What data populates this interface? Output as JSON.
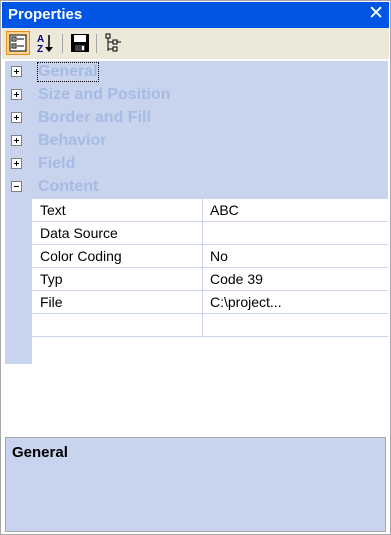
{
  "window": {
    "title": "Properties",
    "close_glyph": "✕"
  },
  "toolbar": {
    "buttons": [
      {
        "name": "categorized-view-icon",
        "pressed": true
      },
      {
        "name": "sort-alphabetical-icon",
        "pressed": false
      },
      {
        "name": "save-icon",
        "pressed": false
      },
      {
        "name": "hierarchy-icon",
        "pressed": false
      }
    ]
  },
  "categories": [
    {
      "label": "General",
      "expanded": false
    },
    {
      "label": "Size and Position",
      "expanded": false
    },
    {
      "label": "Border and Fill",
      "expanded": false
    },
    {
      "label": "Behavior",
      "expanded": false
    },
    {
      "label": "Field",
      "expanded": false
    },
    {
      "label": "Content",
      "expanded": true
    }
  ],
  "properties": [
    {
      "name": "Text",
      "value": "ABC"
    },
    {
      "name": "Data Source",
      "value": ""
    },
    {
      "name": "Color Coding",
      "value": "No"
    },
    {
      "name": "Typ",
      "value": "Code 39"
    },
    {
      "name": "File",
      "value": "C:\\project..."
    }
  ],
  "help": {
    "title": "General"
  },
  "colors": {
    "titlebar": "#0055e5",
    "category_bg": "#c8d4ed",
    "category_text": "#a6bbe4",
    "toolbar_bg": "#ece9d8",
    "pressed_button": "#ffd48e"
  }
}
